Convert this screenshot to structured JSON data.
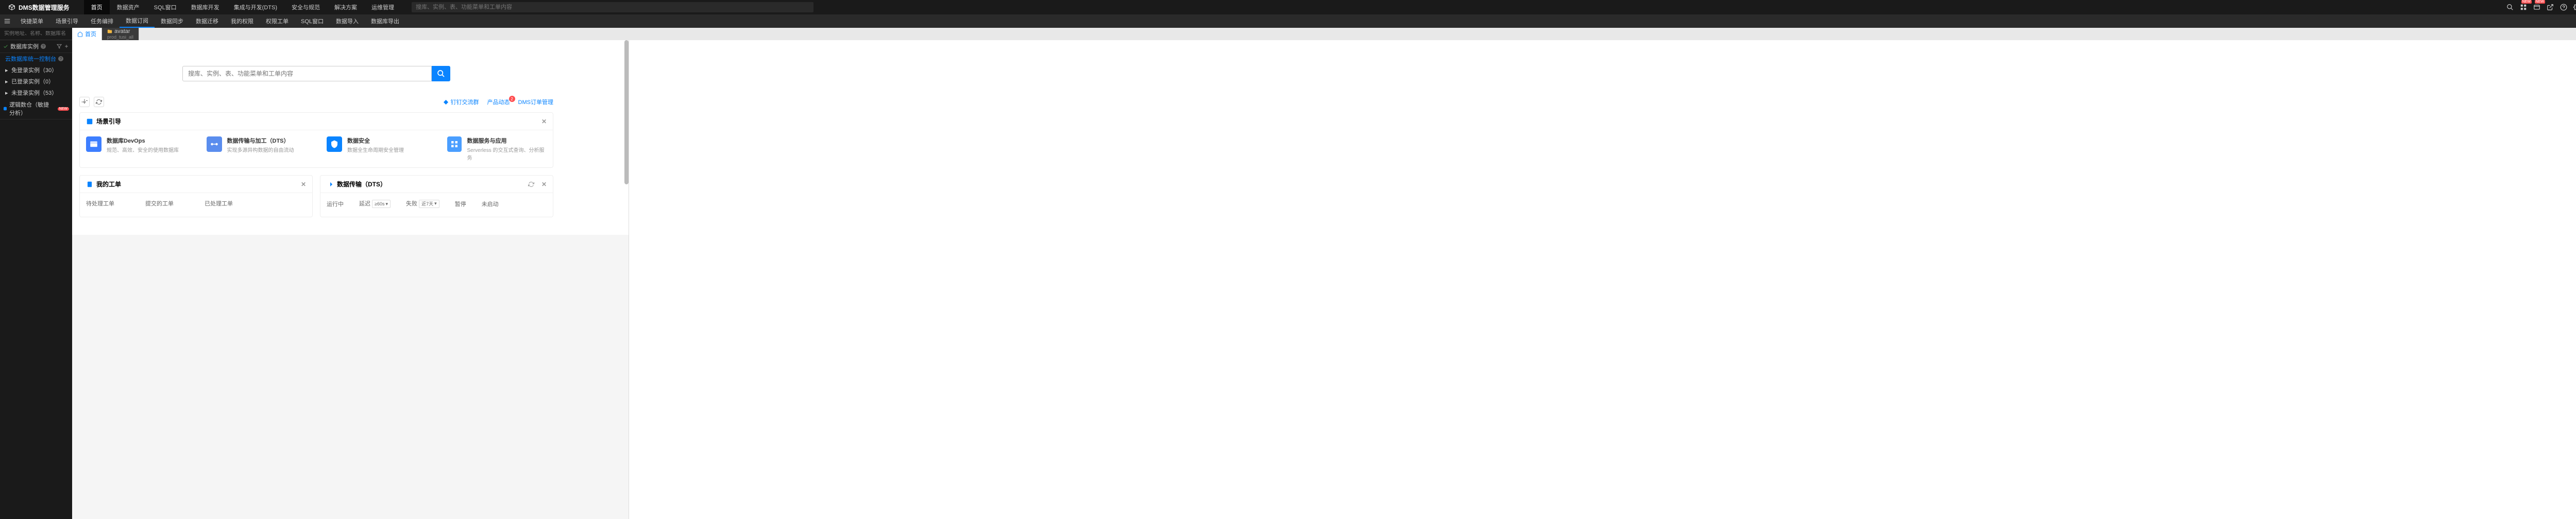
{
  "header": {
    "logo_text": "DMS数据管理服务",
    "nav": [
      "首页",
      "数据资产",
      "SQL窗口",
      "数据库开发",
      "集成与开发(DTS)",
      "安全与规范",
      "解决方案",
      "运维管理"
    ],
    "search_placeholder": "搜库、实例、表、功能菜单和工单内容",
    "badge_new": "NEW"
  },
  "subnav": {
    "items": [
      "快捷菜单",
      "场景引导",
      "任务编排",
      "数据订阅",
      "数据同步",
      "数据迁移",
      "我的权限",
      "权限工单",
      "SQL窗口",
      "数据导入",
      "数据库导出"
    ]
  },
  "sidebar": {
    "search_placeholder": "实例地址、名称、数据库名",
    "section1_title": "数据库实例",
    "item_highlight": "云数据库统一控制台",
    "items": [
      {
        "label": "免登录实例（30）"
      },
      {
        "label": "已登录实例（0）"
      },
      {
        "label": "未登录实例（53）"
      }
    ],
    "section2_title": "逻辑数仓（敏捷分析）",
    "new_badge": "NEW"
  },
  "tabs": {
    "home": "首页",
    "avatar_tab": "avatar",
    "avatar_sub": "prod_tusi_all"
  },
  "dashboard": {
    "search_placeholder": "搜库、实例、表、功能菜单和工单内容",
    "links": {
      "dingding": "钉钉交流群",
      "product_news": "产品动态",
      "product_news_count": "2",
      "dms_order": "DMS订单管理"
    },
    "scene": {
      "title": "场景引导",
      "items": [
        {
          "title": "数据库DevOps",
          "desc": "规范、高效、安全的使用数据库"
        },
        {
          "title": "数据传输与加工（DTS）",
          "desc": "实现多源异构数据的自由流动"
        },
        {
          "title": "数据安全",
          "desc": "数据全生命周期安全管理"
        },
        {
          "title": "数据服务与应用",
          "desc": "Serverless 的交互式查询、分析服务"
        }
      ]
    },
    "orders": {
      "title": "我的工单",
      "stats": [
        {
          "label": "待处理工单"
        },
        {
          "label": "提交的工单"
        },
        {
          "label": "已处理工单"
        }
      ]
    },
    "dts": {
      "title": "数据传输（DTS）",
      "items": [
        {
          "label": "运行中"
        },
        {
          "label": "延迟",
          "select": "≥60s"
        },
        {
          "label": "失败",
          "select": "近7天"
        },
        {
          "label": "暂停"
        },
        {
          "label": "未启动"
        }
      ]
    }
  }
}
